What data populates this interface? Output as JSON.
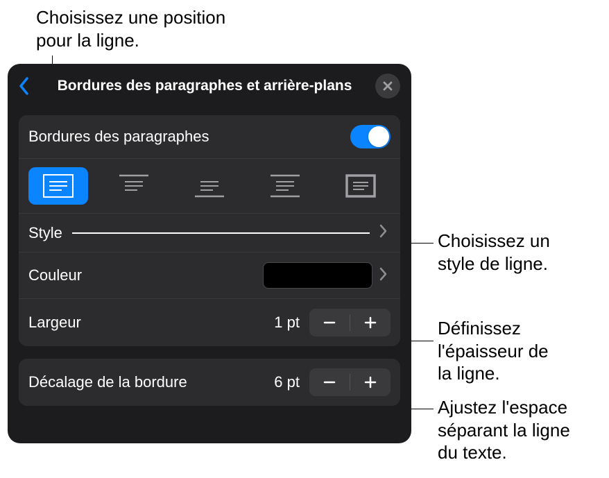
{
  "callouts": {
    "position": "Choisissez une position\npour la ligne.",
    "style": "Choisissez un\nstyle de ligne.",
    "width": "Définissez\nl'épaisseur de\nla ligne.",
    "offset": "Ajustez l'espace\nséparant la ligne\ndu texte."
  },
  "panel": {
    "title": "Bordures des paragraphes et arrière-plans"
  },
  "section1": {
    "borders_label": "Bordures des paragraphes",
    "style_label": "Style",
    "color_label": "Couleur",
    "width_label": "Largeur",
    "width_value": "1 pt",
    "color_value": "#000000"
  },
  "section2": {
    "offset_label": "Décalage de la bordure",
    "offset_value": "6 pt"
  },
  "toggle": {
    "on": true
  },
  "accent": "#0a84ff"
}
